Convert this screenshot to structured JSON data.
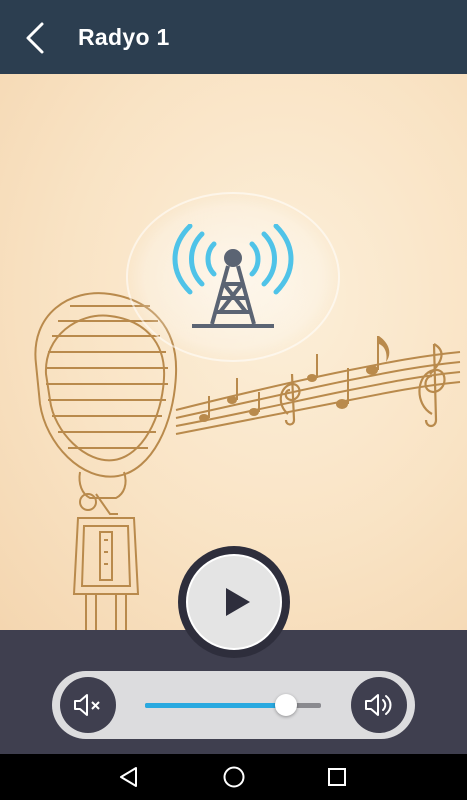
{
  "appbar": {
    "title": "Radyo 1",
    "back_icon": "chevron-left-icon",
    "background": "#2c3e50"
  },
  "stage": {
    "illustration": "microphone-with-music-notes",
    "broadcast_icon": "radio-tower-icon",
    "signal_color": "#4fc3e8",
    "tower_color": "#5b6473"
  },
  "player": {
    "play_icon": "play-icon",
    "state": "stopped"
  },
  "volume": {
    "mute_icon": "volume-mute-icon",
    "volume_up_icon": "volume-up-icon",
    "level": 0.8,
    "accent": "#29a9e0"
  },
  "system_nav": {
    "back_icon": "triangle-back-icon",
    "home_icon": "circle-home-icon",
    "recents_icon": "square-recents-icon"
  }
}
